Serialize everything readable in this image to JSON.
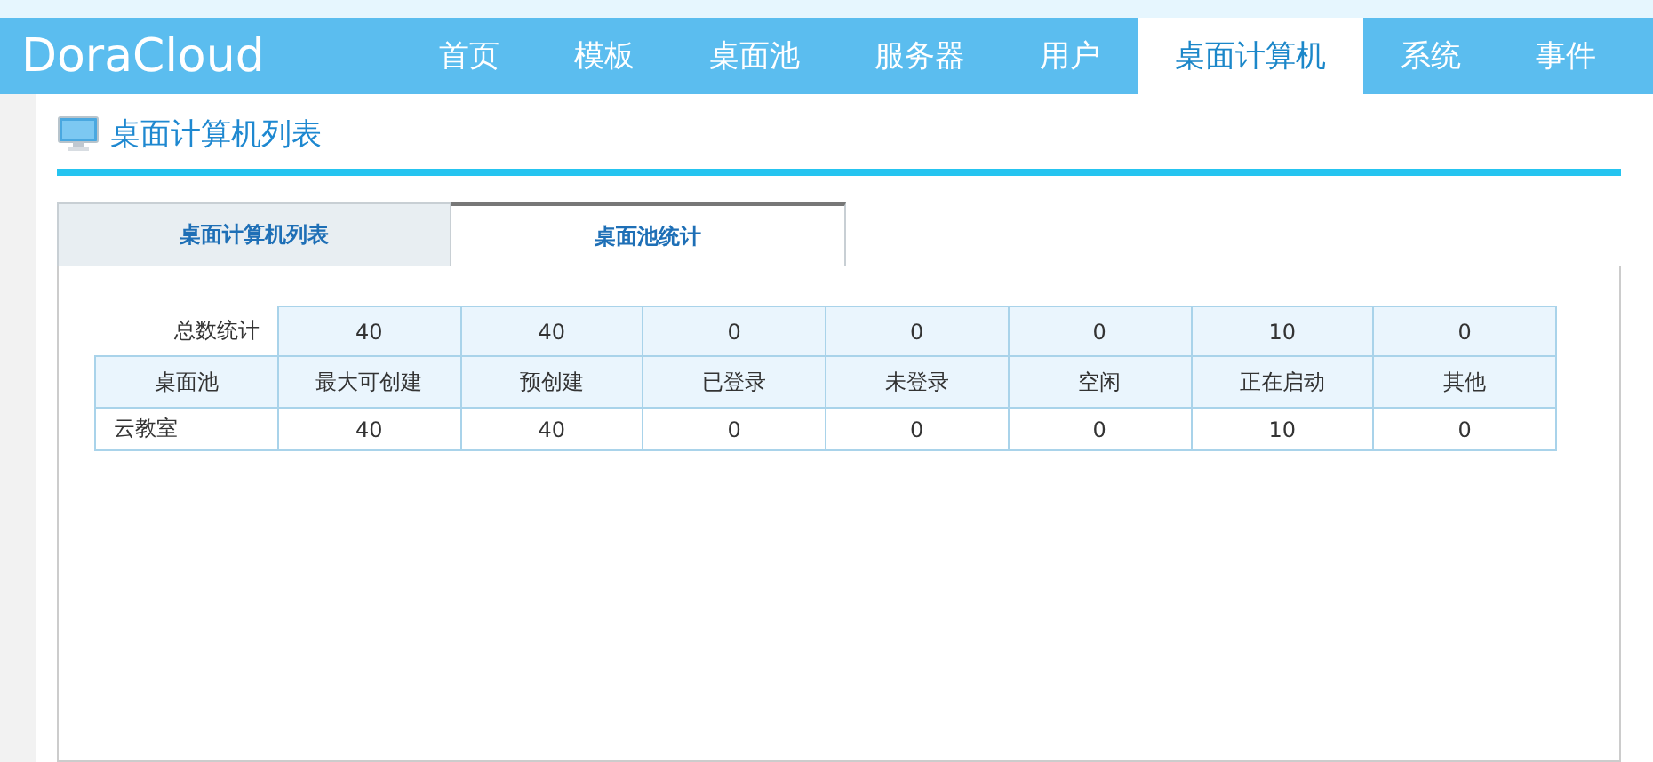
{
  "logo": "DoraCloud",
  "nav": [
    {
      "label": "首页",
      "selected": false
    },
    {
      "label": "模板",
      "selected": false
    },
    {
      "label": "桌面池",
      "selected": false
    },
    {
      "label": "服务器",
      "selected": false
    },
    {
      "label": "用户",
      "selected": false
    },
    {
      "label": "桌面计算机",
      "selected": true
    },
    {
      "label": "系统",
      "selected": false
    },
    {
      "label": "事件",
      "selected": false
    }
  ],
  "page_title": "桌面计算机列表",
  "tabs": [
    {
      "label": "桌面计算机列表",
      "selected": false
    },
    {
      "label": "桌面池统计",
      "selected": true
    }
  ],
  "table": {
    "totals_label": "总数统计",
    "totals": [
      "40",
      "40",
      "0",
      "0",
      "0",
      "10",
      "0"
    ],
    "columns": [
      "桌面池",
      "最大可创建",
      "预创建",
      "已登录",
      "未登录",
      "空闲",
      "正在启动",
      "其他"
    ],
    "rows": [
      [
        "云教室",
        "40",
        "40",
        "0",
        "0",
        "0",
        "10",
        "0"
      ]
    ]
  }
}
